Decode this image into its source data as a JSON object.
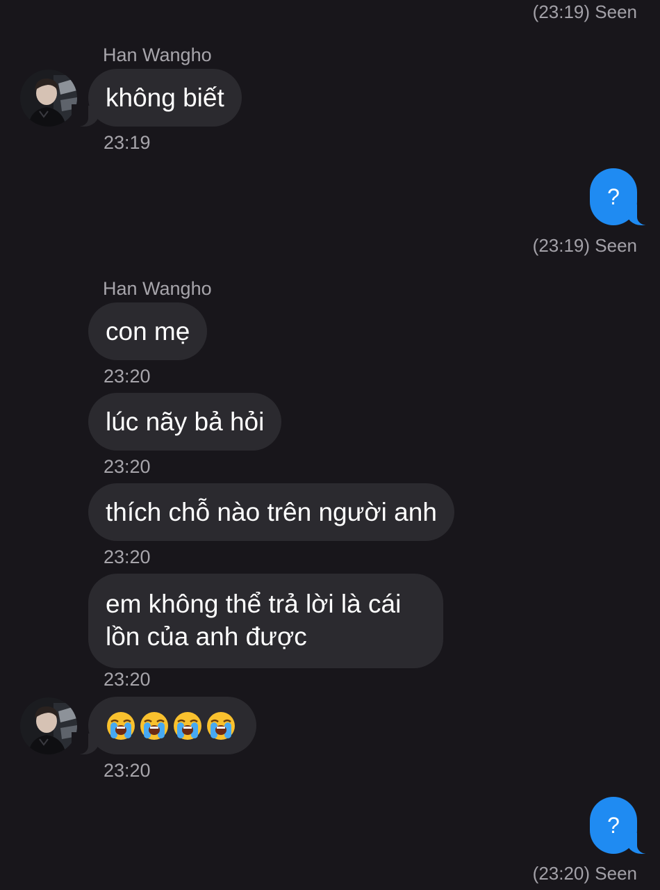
{
  "contact": {
    "name": "Han Wangho"
  },
  "messages": [
    {
      "type": "meta",
      "text": "(23:19) Seen"
    },
    {
      "type": "sender",
      "text": "Han Wangho"
    },
    {
      "type": "received",
      "text": "không biết",
      "time": "23:19",
      "avatar": true
    },
    {
      "type": "sent",
      "text": "?",
      "meta": "(23:19) Seen"
    },
    {
      "type": "sender",
      "text": "Han Wangho"
    },
    {
      "type": "received",
      "text": "con mẹ",
      "time": "23:20"
    },
    {
      "type": "received",
      "text": "lúc nãy bả hỏi",
      "time": "23:20"
    },
    {
      "type": "received",
      "text": "thích chỗ nào trên người anh",
      "time": "23:20"
    },
    {
      "type": "received",
      "text": "em không thể trả lời là cái lồn của anh được",
      "time": "23:20"
    },
    {
      "type": "received",
      "text": "😭😭😭😭",
      "time": "23:20",
      "avatar": true,
      "emoji": "loudly-crying-face",
      "emoji_count": 4
    },
    {
      "type": "sent",
      "text": "?",
      "meta": "(23:20) Seen"
    }
  ],
  "colors": {
    "background": "#18161b",
    "received_bubble": "#2b2a2f",
    "sent_bubble": "#1f8bf2",
    "meta_text": "#a7a5ab"
  },
  "icons": {
    "avatar": "profile-photo",
    "emoji": "loudly-crying-face-emoji"
  }
}
